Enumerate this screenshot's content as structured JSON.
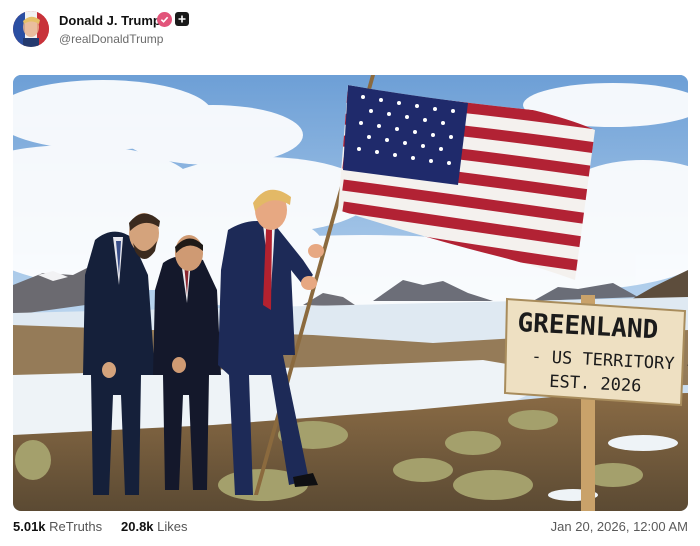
{
  "post": {
    "author_name": "Donald J. Trump",
    "handle": "@realDonaldTrump",
    "verified_icon": "verified-badge-icon",
    "plus_icon": "plus-icon",
    "timestamp": "Jan 20, 2026, 12:00 AM"
  },
  "stats": {
    "retruths_count": "5.01k",
    "retruths_label": "ReTruths",
    "likes_count": "20.8k",
    "likes_label": "Likes"
  },
  "image": {
    "sign_line1": "GREENLAND",
    "sign_line2": "- US TERRITORY -",
    "sign_line3": "EST. 2026"
  },
  "colors": {
    "verified": "#e2547a",
    "sky": "#9ec3e6",
    "flag_red": "#b22234",
    "flag_blue": "#1f2a6b"
  }
}
